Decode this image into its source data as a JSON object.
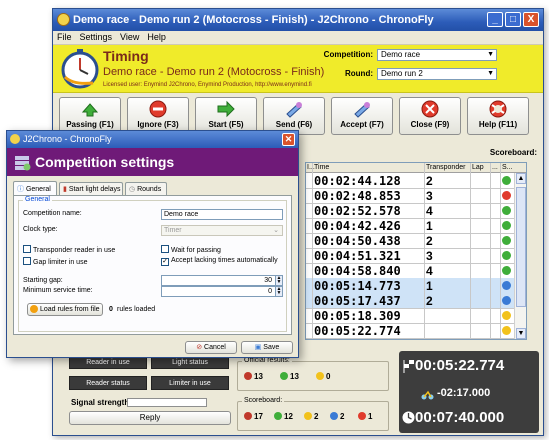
{
  "main_window": {
    "title": "Demo race - Demo run 2 (Motocross - Finish) - J2Chrono - ChronoFly",
    "menu": [
      "File",
      "Settings",
      "View",
      "Help"
    ],
    "controls": {
      "minimize": "_",
      "maximize": "□",
      "close": "X"
    }
  },
  "header": {
    "title": "Timing",
    "subtitle": "Demo race - Demo run 2 (Motocross - Finish)",
    "license": "Licensed user: Enymind J2Chrono, Enymind Production, http://www.enymind.fi",
    "competition_label": "Competition:",
    "competition_value": "Demo race",
    "round_label": "Round:",
    "round_value": "Demo run 2"
  },
  "toolbar": [
    {
      "label": "Passing (F1)",
      "icon": "green-arrow-icon"
    },
    {
      "label": "Ignore (F3)",
      "icon": "no-entry-icon"
    },
    {
      "label": "Start (F5)",
      "icon": "green-right-arrow-icon"
    },
    {
      "label": "Send (F6)",
      "icon": "send-icon"
    },
    {
      "label": "Accept (F7)",
      "icon": "accept-icon"
    },
    {
      "label": "Close (F9)",
      "icon": "close-circle-icon"
    },
    {
      "label": "Help (F11)",
      "icon": "help-lifebuoy-icon"
    }
  ],
  "scoreboard_label": "Scoreboard:",
  "table": {
    "columns": {
      "i": "I...",
      "time": "Time",
      "transponder": "Transponder",
      "lap": "Lap",
      "dots": "...",
      "s": "S..."
    },
    "rows": [
      {
        "time": "00:02:44.128",
        "transponder": "2",
        "status": "green",
        "selected": false
      },
      {
        "time": "00:02:48.853",
        "transponder": "3",
        "status": "red",
        "selected": false
      },
      {
        "time": "00:02:52.578",
        "transponder": "4",
        "status": "green",
        "selected": false
      },
      {
        "time": "00:04:42.426",
        "transponder": "1",
        "status": "green",
        "selected": false
      },
      {
        "time": "00:04:50.438",
        "transponder": "2",
        "status": "green",
        "selected": false
      },
      {
        "time": "00:04:51.321",
        "transponder": "3",
        "status": "green",
        "selected": false
      },
      {
        "time": "00:04:58.840",
        "transponder": "4",
        "status": "green",
        "selected": false
      },
      {
        "time": "00:05:14.773",
        "transponder": "1",
        "status": "blue",
        "selected": true
      },
      {
        "time": "00:05:17.437",
        "transponder": "2",
        "status": "blue",
        "selected": true
      },
      {
        "time": "00:05:18.309",
        "transponder": "",
        "status": "yellow",
        "selected": false
      },
      {
        "time": "00:05:22.774",
        "transponder": "",
        "status": "yellow",
        "selected": false
      }
    ]
  },
  "bottom": {
    "reader_in_use": "Reader in use",
    "light_status": "Light status",
    "reader_status": "Reader status",
    "limiter_in_use": "Limiter in use",
    "signal_strength": "Signal strength:",
    "reply": "Reply",
    "official_results_label": "Official results:",
    "official_counts": [
      "13",
      "13",
      "0"
    ],
    "scoreboard_group_label": "Scoreboard:",
    "scoreboard_counts": [
      "17",
      "12",
      "2",
      "2",
      "1"
    ],
    "timer_main": "00:05:22.774",
    "timer_diff": "-02:17.000",
    "timer_clock": "00:07:40.000"
  },
  "dialog": {
    "title": "J2Chrono - ChronoFly",
    "heading": "Competition settings",
    "tabs": [
      "General",
      "Start light delays",
      "Rounds"
    ],
    "fieldset": "General",
    "competition_name_label": "Competition name:",
    "competition_name_value": "Demo race",
    "clock_type_label": "Clock type:",
    "clock_type_value": "Timer",
    "transponder_reader": "Transponder reader in use",
    "wait_for_passing": "Wait for passing",
    "gap_limiter": "Gap limiter in use",
    "accept_lacking": "Accept lacking times automatically",
    "starting_gap_label": "Starting gap:",
    "starting_gap_value": "30",
    "min_service_label": "Minimum service time:",
    "min_service_value": "0",
    "load_rules": "Load rules from file",
    "rules_loaded_count": "0",
    "rules_loaded_text": "rules loaded",
    "cancel": "Cancel",
    "save": "Save",
    "colors": {
      "header_bg": "#6f1a78",
      "main_header_bg": "#f0eb2a"
    }
  }
}
